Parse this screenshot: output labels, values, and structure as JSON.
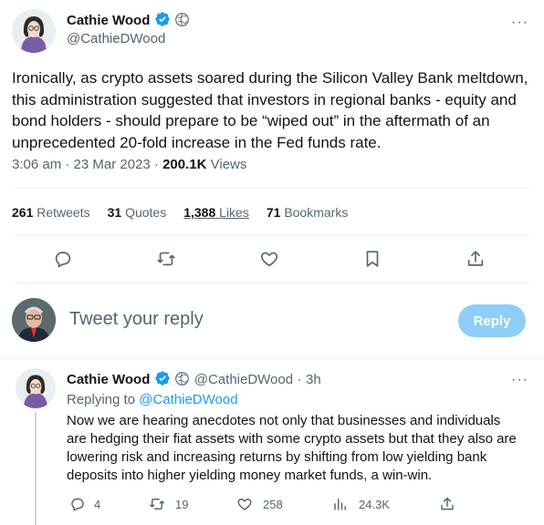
{
  "main_tweet": {
    "author_name": "Cathie Wood",
    "author_handle": "@CathieDWood",
    "text": "Ironically, as crypto assets soared during the Silicon Valley Bank meltdown, this administration suggested that investors in regional banks - equity and bond holders - should prepare to be “wiped out” in the aftermath of an unprecedented 20-fold increase in the Fed funds rate.",
    "time": "3:06 am · 23 Mar 2023 · ",
    "views_count": "200.1K",
    "views_label": " Views",
    "stats": {
      "retweets_count": "261",
      "retweets_label": "Retweets",
      "quotes_count": "31",
      "quotes_label": "Quotes",
      "likes_count": "1,388",
      "likes_label": "Likes",
      "bookmarks_count": "71",
      "bookmarks_label": "Bookmarks"
    },
    "more": "···"
  },
  "composer": {
    "placeholder": "Tweet your reply",
    "reply_label": "Reply"
  },
  "thread_tweet": {
    "author_name": "Cathie Wood",
    "author_handle": "@CathieDWood",
    "sep": "·",
    "age": "3h",
    "replying_prefix": "Replying to ",
    "replying_to": "@CathieDWood",
    "text": "Now we are hearing anecdotes not only that businesses and individuals are hedging their fiat assets with some crypto assets but that they also are lowering risk and increasing returns by shifting from low yielding bank deposits into higher yielding money market funds, a win-win.",
    "replies": "4",
    "retweets": "19",
    "likes": "258",
    "views": "24.3K",
    "more": "···"
  },
  "colors": {
    "accent": "#1d9bf0",
    "text": "#0f1419",
    "muted": "#536471",
    "reply_button": "#8ecdf8"
  },
  "icons": [
    "verified-badge-icon",
    "globe-badge-icon",
    "more-icon",
    "reply-icon",
    "retweet-icon",
    "like-icon",
    "bookmark-icon",
    "share-icon",
    "views-icon"
  ]
}
